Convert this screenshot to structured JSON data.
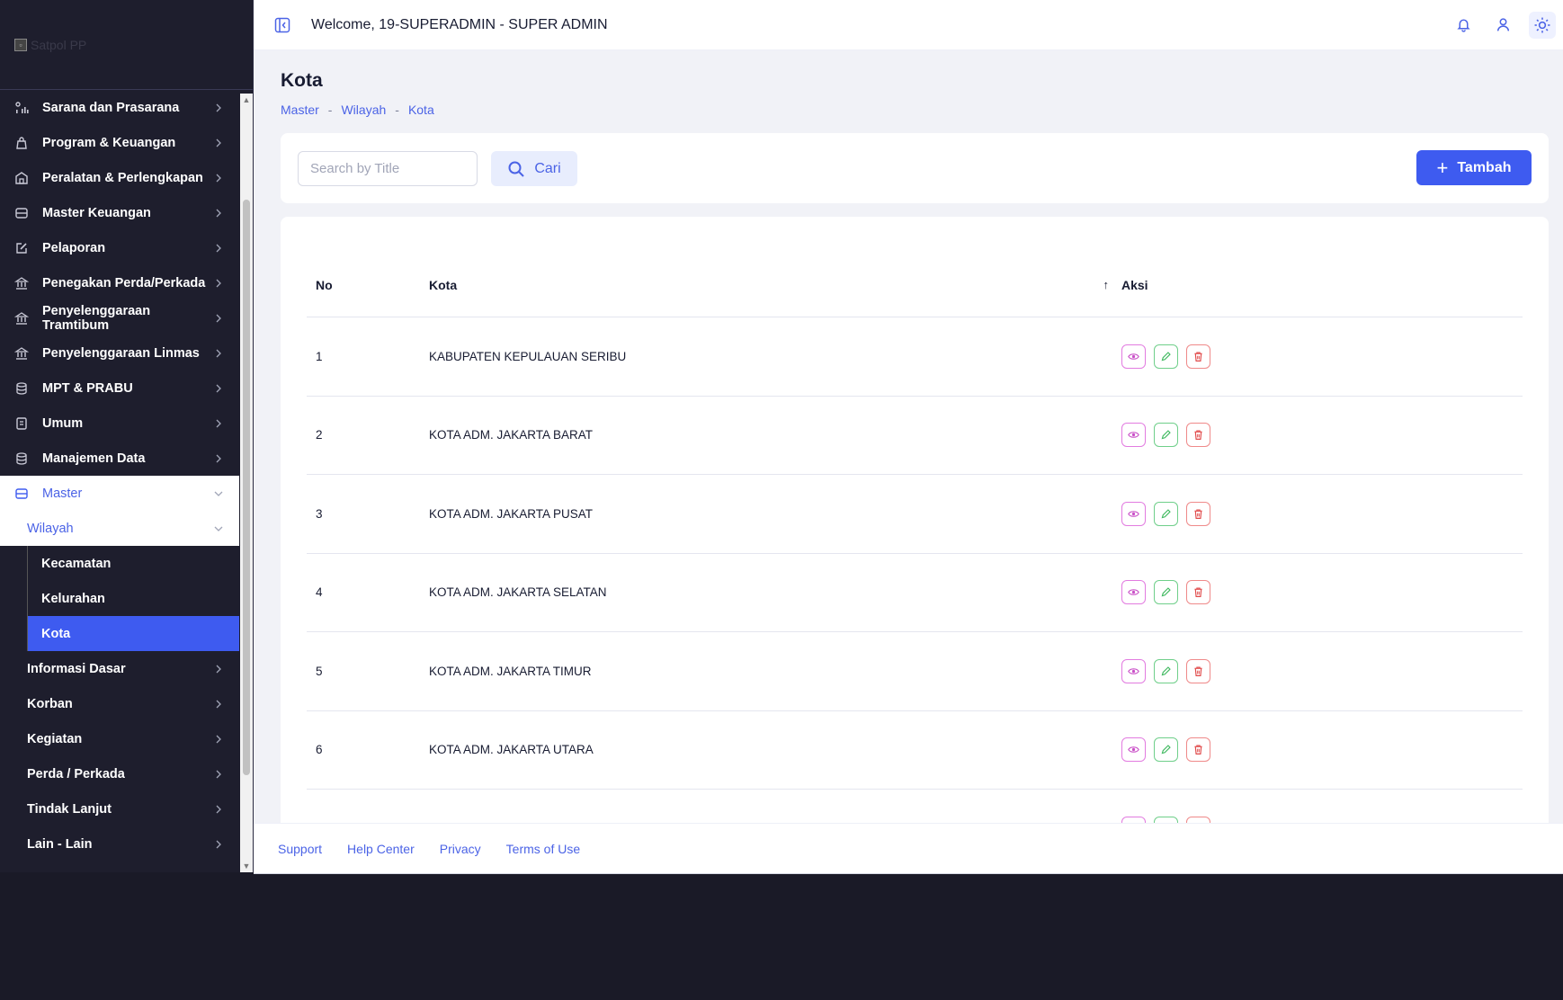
{
  "header": {
    "welcome": "Welcome, 19-SUPERADMIN - SUPER ADMIN"
  },
  "sidebar": {
    "logo_alt": "Satpol PP",
    "items": [
      {
        "label": "Sarana dan Prasarana",
        "icon": "chart-icon"
      },
      {
        "label": "Program & Keuangan",
        "icon": "bag-icon"
      },
      {
        "label": "Peralatan & Perlengkapan",
        "icon": "building-icon"
      },
      {
        "label": "Master Keuangan",
        "icon": "server-icon"
      },
      {
        "label": "Pelaporan",
        "icon": "edit-icon"
      },
      {
        "label": "Penegakan Perda/Perkada",
        "icon": "bank-icon"
      },
      {
        "label": "Penyelenggaraan Tramtibum",
        "icon": "bank-icon"
      },
      {
        "label": "Penyelenggaraan Linmas",
        "icon": "bank-icon"
      },
      {
        "label": "MPT & PRABU",
        "icon": "database-icon"
      },
      {
        "label": "Umum",
        "icon": "document-icon"
      },
      {
        "label": "Manajemen Data",
        "icon": "database-icon"
      }
    ],
    "master": {
      "label": "Master"
    },
    "wilayah": {
      "label": "Wilayah",
      "children": [
        {
          "label": "Kecamatan"
        },
        {
          "label": "Kelurahan"
        },
        {
          "label": "Kota"
        }
      ]
    },
    "master_children": [
      {
        "label": "Informasi Dasar"
      },
      {
        "label": "Korban"
      },
      {
        "label": "Kegiatan"
      },
      {
        "label": "Perda / Perkada"
      },
      {
        "label": "Tindak Lanjut"
      },
      {
        "label": "Lain - Lain"
      }
    ]
  },
  "page": {
    "title": "Kota",
    "breadcrumb": [
      "Master",
      "Wilayah",
      "Kota"
    ],
    "breadcrumb_sep": "-"
  },
  "search": {
    "placeholder": "Search by Title",
    "value": "",
    "cari_label": "Cari",
    "tambah_label": "Tambah"
  },
  "table": {
    "columns": {
      "no": "No",
      "kota": "Kota",
      "aksi": "Aksi"
    },
    "sort_indicator": "↑",
    "rows": [
      {
        "no": "1",
        "kota": "KABUPATEN KEPULAUAN SERIBU"
      },
      {
        "no": "2",
        "kota": "KOTA ADM. JAKARTA BARAT"
      },
      {
        "no": "3",
        "kota": "KOTA ADM. JAKARTA PUSAT"
      },
      {
        "no": "4",
        "kota": "KOTA ADM. JAKARTA SELATAN"
      },
      {
        "no": "5",
        "kota": "KOTA ADM. JAKARTA TIMUR"
      },
      {
        "no": "6",
        "kota": "KOTA ADM. JAKARTA UTARA"
      }
    ]
  },
  "footer": {
    "links": [
      "Support",
      "Help Center",
      "Privacy",
      "Terms of Use"
    ]
  },
  "colors": {
    "primary": "#3e5bf0",
    "sidebar_bg": "#1e1e2d",
    "view": "#c94fc7",
    "edit": "#3fb95f",
    "delete": "#e04848"
  }
}
